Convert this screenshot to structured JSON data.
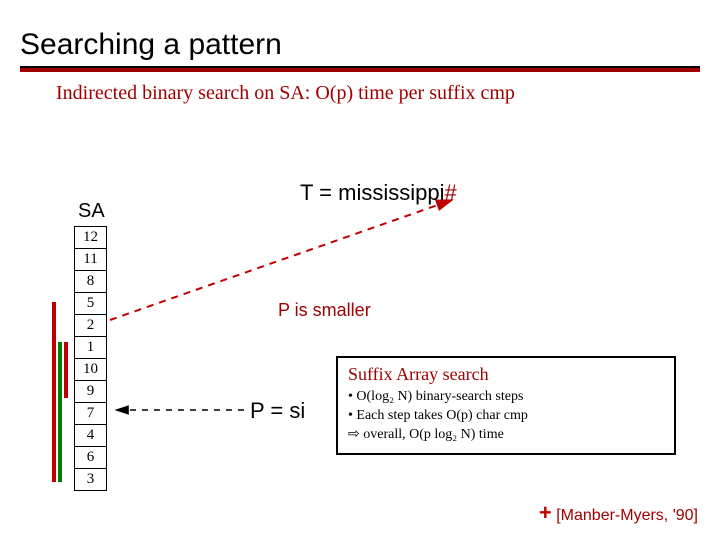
{
  "title": "Searching a pattern",
  "subtitle": "Indirected binary search on SA: O(p) time per suffix cmp",
  "t_label": "T = mississippi",
  "t_terminator": "#",
  "sa_label": "SA",
  "sa_values": [
    "12",
    "11",
    "8",
    "5",
    "2",
    "1",
    "10",
    "9",
    "7",
    "4",
    "6",
    "3"
  ],
  "p_smaller": "P is smaller",
  "p_equals": "P = si",
  "suffix_box": {
    "heading": "Suffix Array search",
    "line1": "O(log₂ N) binary-search steps",
    "line2": "Each step takes O(p) char cmp",
    "overall": "overall, O(p log₂ N) time"
  },
  "citation_plus": "+",
  "citation": " [Manber-Myers, '90]"
}
